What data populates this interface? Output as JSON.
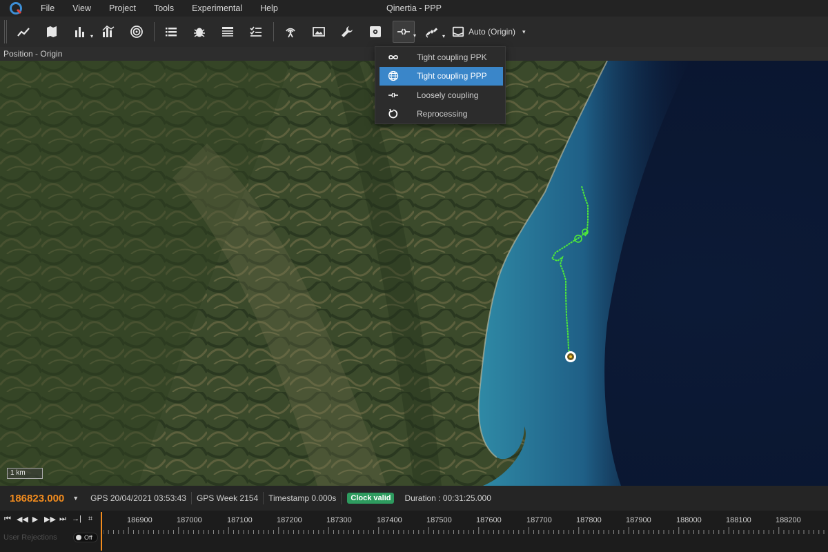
{
  "window": {
    "title": "Qinertia - PPP"
  },
  "menu": [
    "File",
    "View",
    "Project",
    "Tools",
    "Experimental",
    "Help"
  ],
  "toolbar": {
    "buttons": [
      {
        "name": "line-chart-icon"
      },
      {
        "name": "map-icon"
      },
      {
        "name": "bar-chart-icon"
      },
      {
        "name": "bar-chart-2-icon"
      },
      {
        "name": "radar-icon"
      },
      {
        "name": "list-icon"
      },
      {
        "name": "bug-icon"
      },
      {
        "name": "table-icon"
      },
      {
        "name": "checklist-icon"
      },
      {
        "name": "antenna-icon"
      },
      {
        "name": "image-icon"
      },
      {
        "name": "wrench-icon"
      },
      {
        "name": "settings-box-icon"
      },
      {
        "name": "coupling-icon"
      },
      {
        "name": "satellite-icon"
      }
    ],
    "origin_label": "Auto (Origin)"
  },
  "panel": {
    "title": "Position - Origin"
  },
  "dropdown": {
    "items": [
      {
        "label": "Tight coupling PPK",
        "icon": "infinity-icon",
        "selected": false
      },
      {
        "label": "Tight coupling PPP",
        "icon": "globe-icon",
        "selected": true
      },
      {
        "label": "Loosely coupling",
        "icon": "loose-coupling-icon",
        "selected": false
      },
      {
        "label": "Reprocessing",
        "icon": "reprocess-icon",
        "selected": false
      }
    ]
  },
  "map": {
    "scale_label": "1 km"
  },
  "status": {
    "epoch": "186823.000",
    "gps_time": "GPS 20/04/2021 03:53:43",
    "gps_week": "GPS Week 2154",
    "timestamp": "Timestamp 0.000s",
    "clock_badge": "Clock valid",
    "duration": "Duration : 00:31:25.000"
  },
  "timeline": {
    "ticks": [
      "186900",
      "187000",
      "187100",
      "187200",
      "187300",
      "187400",
      "187500",
      "187600",
      "187700",
      "187800",
      "187900",
      "188000",
      "188100",
      "188200"
    ],
    "user_rejections_label": "User Rejections",
    "toggle_label": "Off"
  },
  "colors": {
    "accent": "#3a86c9",
    "epoch": "#f28c1e",
    "clock_valid": "#2e9b5f",
    "track": "#4ee83a"
  }
}
